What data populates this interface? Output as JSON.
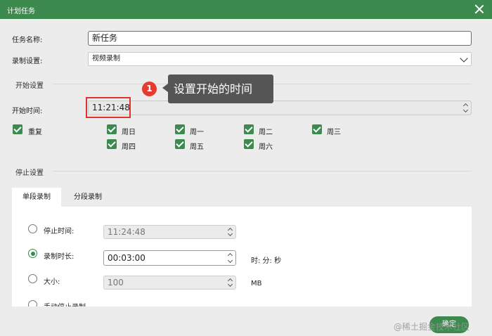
{
  "window": {
    "title": "计划任务"
  },
  "task_name": {
    "label": "任务名称:",
    "value": "新任务"
  },
  "record_setting": {
    "label": "录制设置:",
    "value": "视频录制"
  },
  "start_section": {
    "label": "开始设置"
  },
  "start_time": {
    "label": "开始时间:",
    "value": "11:21:48"
  },
  "callout": {
    "number": "1",
    "text": "设置开始的时间"
  },
  "repeat": {
    "label": "重复",
    "days": [
      "周日",
      "周一",
      "周二",
      "周三",
      "周四",
      "周五",
      "周六"
    ]
  },
  "stop_section": {
    "label": "停止设置"
  },
  "tabs": [
    "单段录制",
    "分段录制"
  ],
  "stop_options": {
    "stop_time": {
      "label": "停止时间:",
      "value": "11:24:48"
    },
    "duration": {
      "label": "录制时长:",
      "value": "00:03:00",
      "unit": "时: 分: 秒"
    },
    "size": {
      "label": "大小:",
      "value": "100",
      "unit": "MB"
    },
    "manual": {
      "label": "手动停止录制"
    }
  },
  "ok_button": {
    "label": "确定"
  },
  "watermark": "@稀土掘金技术社区",
  "colors": {
    "accent": "#3d8a4f",
    "highlight": "#e0322f",
    "callout_bg": "#555555"
  }
}
